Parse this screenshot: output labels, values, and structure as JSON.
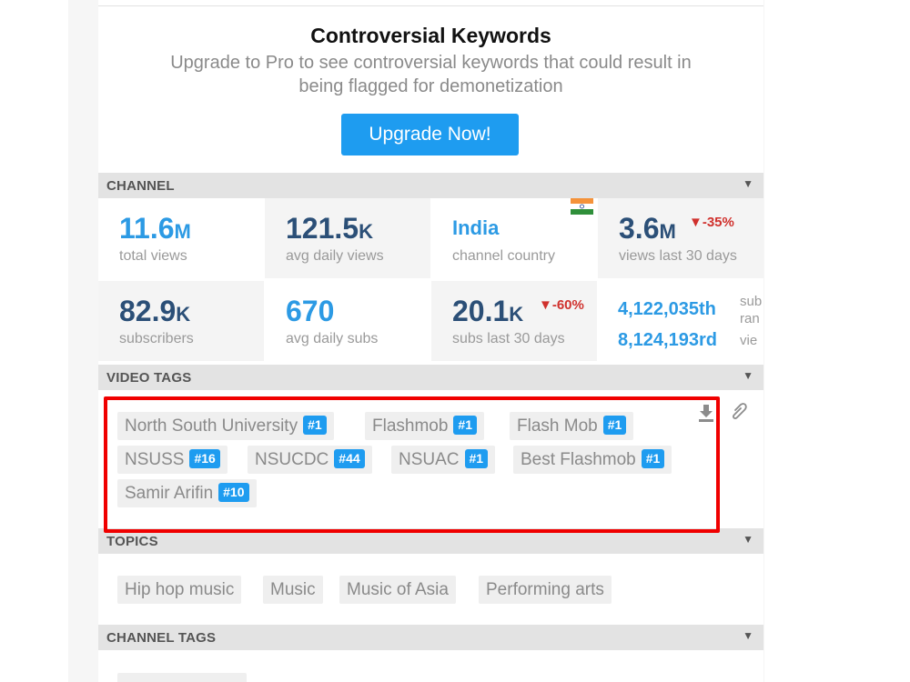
{
  "promo": {
    "title": "Controversial Keywords",
    "subtitle": "Upgrade to Pro to see controversial keywords that could result in being flagged for demonetization",
    "button_label": "Upgrade Now!"
  },
  "sections": {
    "channel": "CHANNEL",
    "video_tags": "VIDEO TAGS",
    "topics": "TOPICS",
    "channel_tags": "CHANNEL TAGS",
    "caret": "▼"
  },
  "channel_stats": {
    "total_views": {
      "value": "11.6",
      "unit": "M",
      "label": "total views"
    },
    "avg_daily_views": {
      "value": "121.5",
      "unit": "K",
      "label": "avg daily views"
    },
    "country": {
      "value": "India",
      "label": "channel country"
    },
    "views_30": {
      "value": "3.6",
      "unit": "M",
      "change": "▼-35%",
      "label": "views last 30 days"
    },
    "subscribers": {
      "value": "82.9",
      "unit": "K",
      "label": "subscribers"
    },
    "avg_daily_subs": {
      "value": "670",
      "label": "avg daily subs"
    },
    "subs_30": {
      "value": "20.1",
      "unit": "K",
      "change": "▼-60%",
      "label": "subs last 30 days"
    },
    "subscriber_rank": {
      "value": "4,122,035th",
      "note": "sub"
    },
    "view_rank": {
      "value": "8,124,193rd",
      "note_top": "ran",
      "note": "vie"
    }
  },
  "video_tags": [
    {
      "text": "North South University",
      "rank": "#1"
    },
    {
      "text": "Flashmob",
      "rank": "#1"
    },
    {
      "text": "Flash Mob",
      "rank": "#1"
    },
    {
      "text": "NSUSS",
      "rank": "#16"
    },
    {
      "text": "NSUCDC",
      "rank": "#44"
    },
    {
      "text": "NSUAC",
      "rank": "#1"
    },
    {
      "text": "Best Flashmob",
      "rank": "#1"
    },
    {
      "text": "Samir Arifin",
      "rank": "#10"
    }
  ],
  "topics": [
    "Hip hop music",
    "Music",
    "Music of Asia",
    "Performing arts"
  ],
  "icons": {
    "download": "download-icon",
    "attach": "paperclip-icon",
    "flag": "india-flag-icon"
  },
  "colors": {
    "accent": "#1e9cf0",
    "stat_blue": "#2c9ae4",
    "stat_dark": "#2b4f77",
    "negative": "#d0312d",
    "highlight": "#f00000"
  }
}
